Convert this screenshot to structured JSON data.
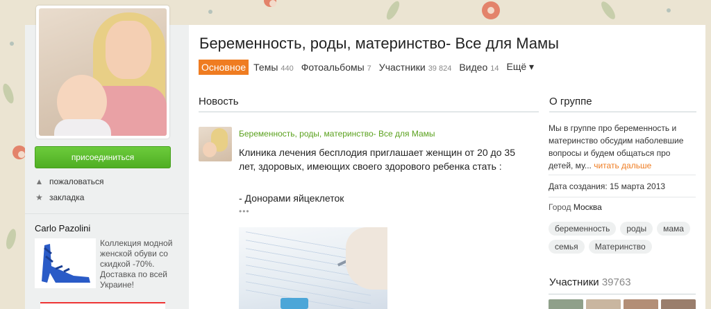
{
  "group": {
    "title": "Беременность, роды, материнство- Все для Мамы"
  },
  "tabs": [
    {
      "label": "Основное",
      "count": ""
    },
    {
      "label": "Темы",
      "count": "440"
    },
    {
      "label": "Фотоальбомы",
      "count": "7"
    },
    {
      "label": "Участники",
      "count": "39 824"
    },
    {
      "label": "Видео",
      "count": "14"
    },
    {
      "label": "Ещё ▾",
      "count": ""
    }
  ],
  "sidebar": {
    "join_label": "присоединиться",
    "complain_label": "пожаловаться",
    "bookmark_label": "закладка",
    "complain_icon": "warning-icon",
    "bookmark_icon": "star-icon"
  },
  "ad": {
    "title": "Carlo Pazolini",
    "text": "Коллекция модной женской обуви со скидкой -70%. Доставка по всей Украине!"
  },
  "feed": {
    "section_title": "Новость",
    "author": "Беременность, роды, материнство- Все для Мамы",
    "text": "Клиника лечения бесплодия приглашает женщин от 20 до 35 лет, здоровых, имеющих своего здорового ребенка стать :",
    "line2": "- Донорами яйцеклеток",
    "more_dots": "•••"
  },
  "about": {
    "section_title": "О группе",
    "text": "Мы в группе про беременность и материнство обсудим наболевшие вопросы и будем общаться про детей, му...",
    "more_label": "читать дальше",
    "created": "Дата создания: 15 марта 2013",
    "city_label": "Город",
    "city_value": "Москва",
    "tags": [
      "беременность",
      "роды",
      "мама",
      "семья",
      "Материнство"
    ]
  },
  "members": {
    "title": "Участники",
    "count": "39763"
  },
  "colors": {
    "accent": "#ef7c21",
    "join_green": "#4fae23",
    "author_green": "#5aa11d"
  }
}
